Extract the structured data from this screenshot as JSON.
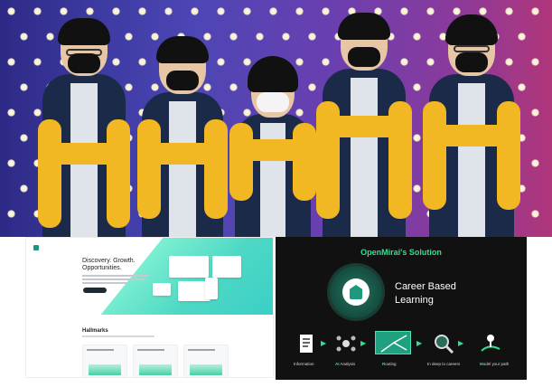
{
  "right_slide": {
    "title": "OpenMirai's Solution",
    "headline_line1": "Career Based",
    "headline_line2": "Learning",
    "steps": [
      {
        "initial": "I",
        "rest": "nformation"
      },
      {
        "initial": "AI",
        "rest": " Analysis"
      },
      {
        "initial": "R",
        "rest": "outing"
      },
      {
        "initial": "I",
        "rest": "n deep to careers"
      },
      {
        "initial": "M",
        "rest": "odel your path"
      }
    ]
  },
  "left_slide": {
    "headline_line1": "Discovery. Growth.",
    "headline_line2": "Opportunities.",
    "section_title": "Hallmarks"
  },
  "colors": {
    "accent_green": "#2ee08f",
    "teal": "#1d9a7d",
    "backdrop_blue": "#3d3aa2",
    "backdrop_pink": "#b0367a",
    "jacket_yellow": "#f1b824",
    "jacket_navy": "#1c2a4a"
  }
}
